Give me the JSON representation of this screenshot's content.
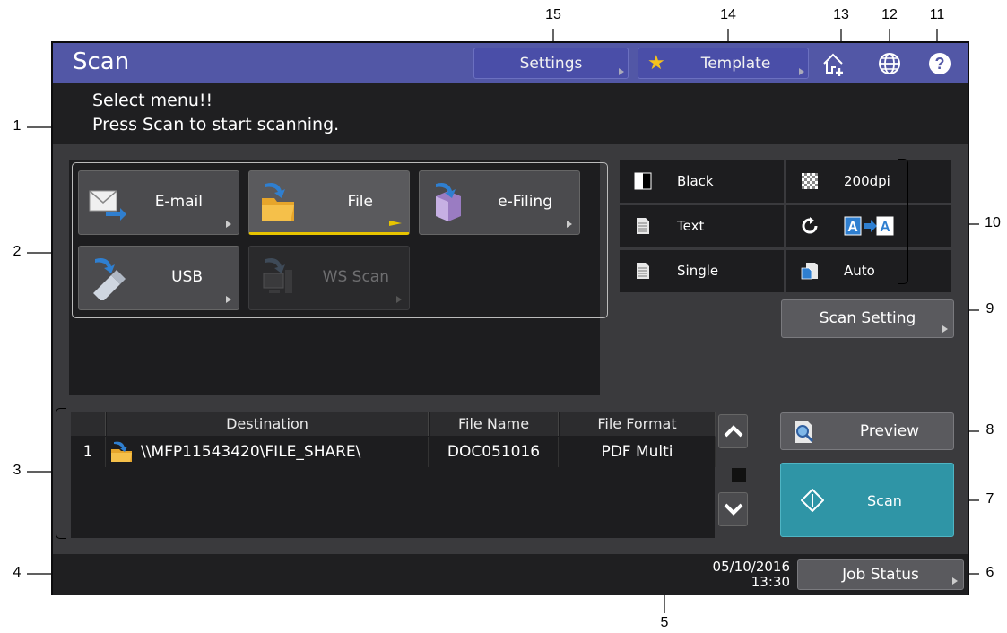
{
  "callouts": [
    "1",
    "2",
    "3",
    "4",
    "5",
    "6",
    "7",
    "8",
    "9",
    "10",
    "11",
    "12",
    "13",
    "14",
    "15"
  ],
  "header": {
    "title": "Scan",
    "settings_label": "Settings",
    "template_label": "Template",
    "icons": [
      "home-add-icon",
      "globe-icon",
      "help-icon"
    ]
  },
  "message": {
    "line1": "Select menu!!",
    "line2": "Press Scan to start scanning."
  },
  "menu": {
    "items": [
      {
        "label": "E-mail",
        "icon": "email-icon",
        "state": "normal"
      },
      {
        "label": "File",
        "icon": "folder-icon",
        "state": "active"
      },
      {
        "label": "e-Filing",
        "icon": "efiling-box-icon",
        "state": "normal"
      },
      {
        "label": "USB",
        "icon": "usb-icon",
        "state": "normal"
      },
      {
        "label": "WS Scan",
        "icon": "computer-icon",
        "state": "disabled"
      }
    ]
  },
  "settings": {
    "color": "Black",
    "resolution": "200dpi",
    "mode": "Text",
    "rotation": "",
    "sides": "Single",
    "size": "Auto",
    "scan_setting_label": "Scan Setting"
  },
  "destination": {
    "headers": [
      "Destination",
      "File Name",
      "File Format"
    ],
    "rows": [
      {
        "num": "1",
        "destination": "\\\\MFP11543420\\FILE_SHARE\\",
        "file_name": "DOC051016",
        "file_format": "PDF Multi"
      }
    ]
  },
  "actions": {
    "preview_label": "Preview",
    "scan_label": "Scan"
  },
  "status": {
    "date": "05/10/2016",
    "time": "13:30",
    "job_status_label": "Job Status"
  },
  "colors": {
    "title_bar": "#5257a6",
    "scan_button": "#2f95a6",
    "active_underline": "#e7c400",
    "star": "#f6c21c"
  }
}
